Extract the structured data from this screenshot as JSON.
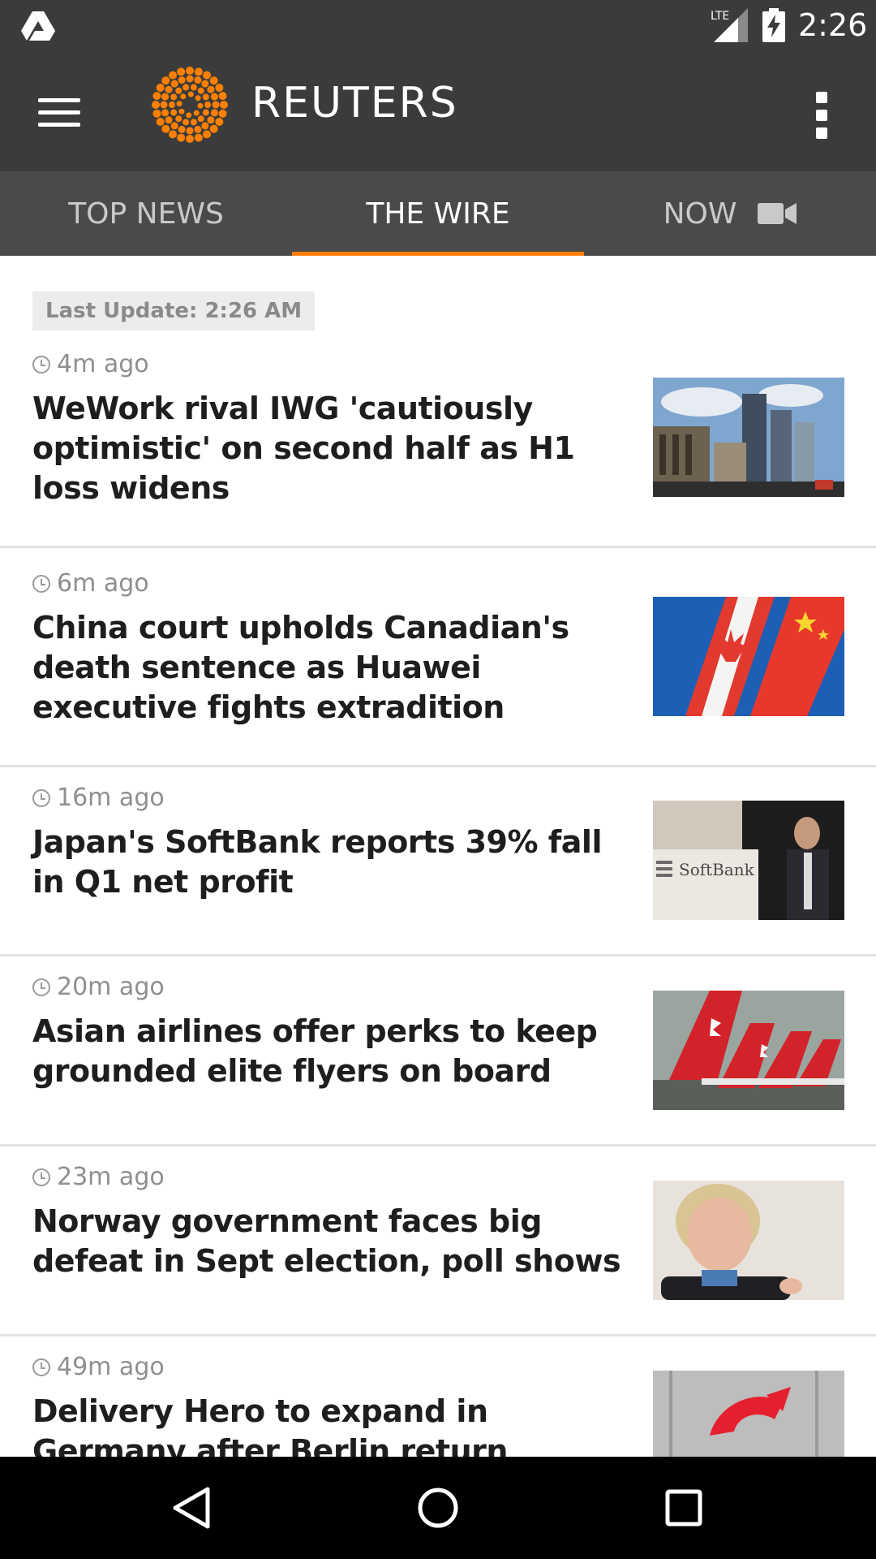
{
  "status_bar": {
    "time": "2:26",
    "network": "LTE",
    "icons": [
      "drive-icon",
      "lte-signal-icon",
      "battery-charging-icon"
    ]
  },
  "app_bar": {
    "brand": "REUTERS",
    "brand_color": "#ff8000",
    "icons": [
      "menu-icon",
      "reuters-logo",
      "overflow-menu-icon"
    ]
  },
  "tabs": [
    {
      "label": "TOP NEWS",
      "active": false
    },
    {
      "label": "THE WIRE",
      "active": true
    },
    {
      "label": "NOW",
      "active": false,
      "icon": "video-camera-icon"
    }
  ],
  "accent_color": "#ff8000",
  "feed": {
    "last_update": "Last Update: 2:26 AM",
    "items": [
      {
        "time": "4m ago",
        "headline": "WeWork rival IWG 'cautiously optimistic' on second half as H1 loss widens",
        "image": "city-buildings-photo"
      },
      {
        "time": "6m ago",
        "headline": "China court upholds Canadian's death sentence as Huawei executive fights extradition",
        "image": "canada-china-flags-photo"
      },
      {
        "time": "16m ago",
        "headline": "Japan's SoftBank reports 39% fall in Q1 net profit",
        "image": "softbank-speaker-photo",
        "image_text": "SoftBank"
      },
      {
        "time": "20m ago",
        "headline": "Asian airlines offer perks to keep grounded elite flyers on board",
        "image": "qantas-planes-photo"
      },
      {
        "time": "23m ago",
        "headline": "Norway government faces big defeat in Sept election, poll shows",
        "image": "politician-portrait-photo"
      },
      {
        "time": "49m ago",
        "headline": "Delivery Hero to expand in Germany after Berlin return",
        "image": "delivery-hero-logo-photo"
      }
    ]
  },
  "nav_bar": {
    "buttons": [
      "back-icon",
      "home-icon",
      "recents-icon"
    ]
  }
}
